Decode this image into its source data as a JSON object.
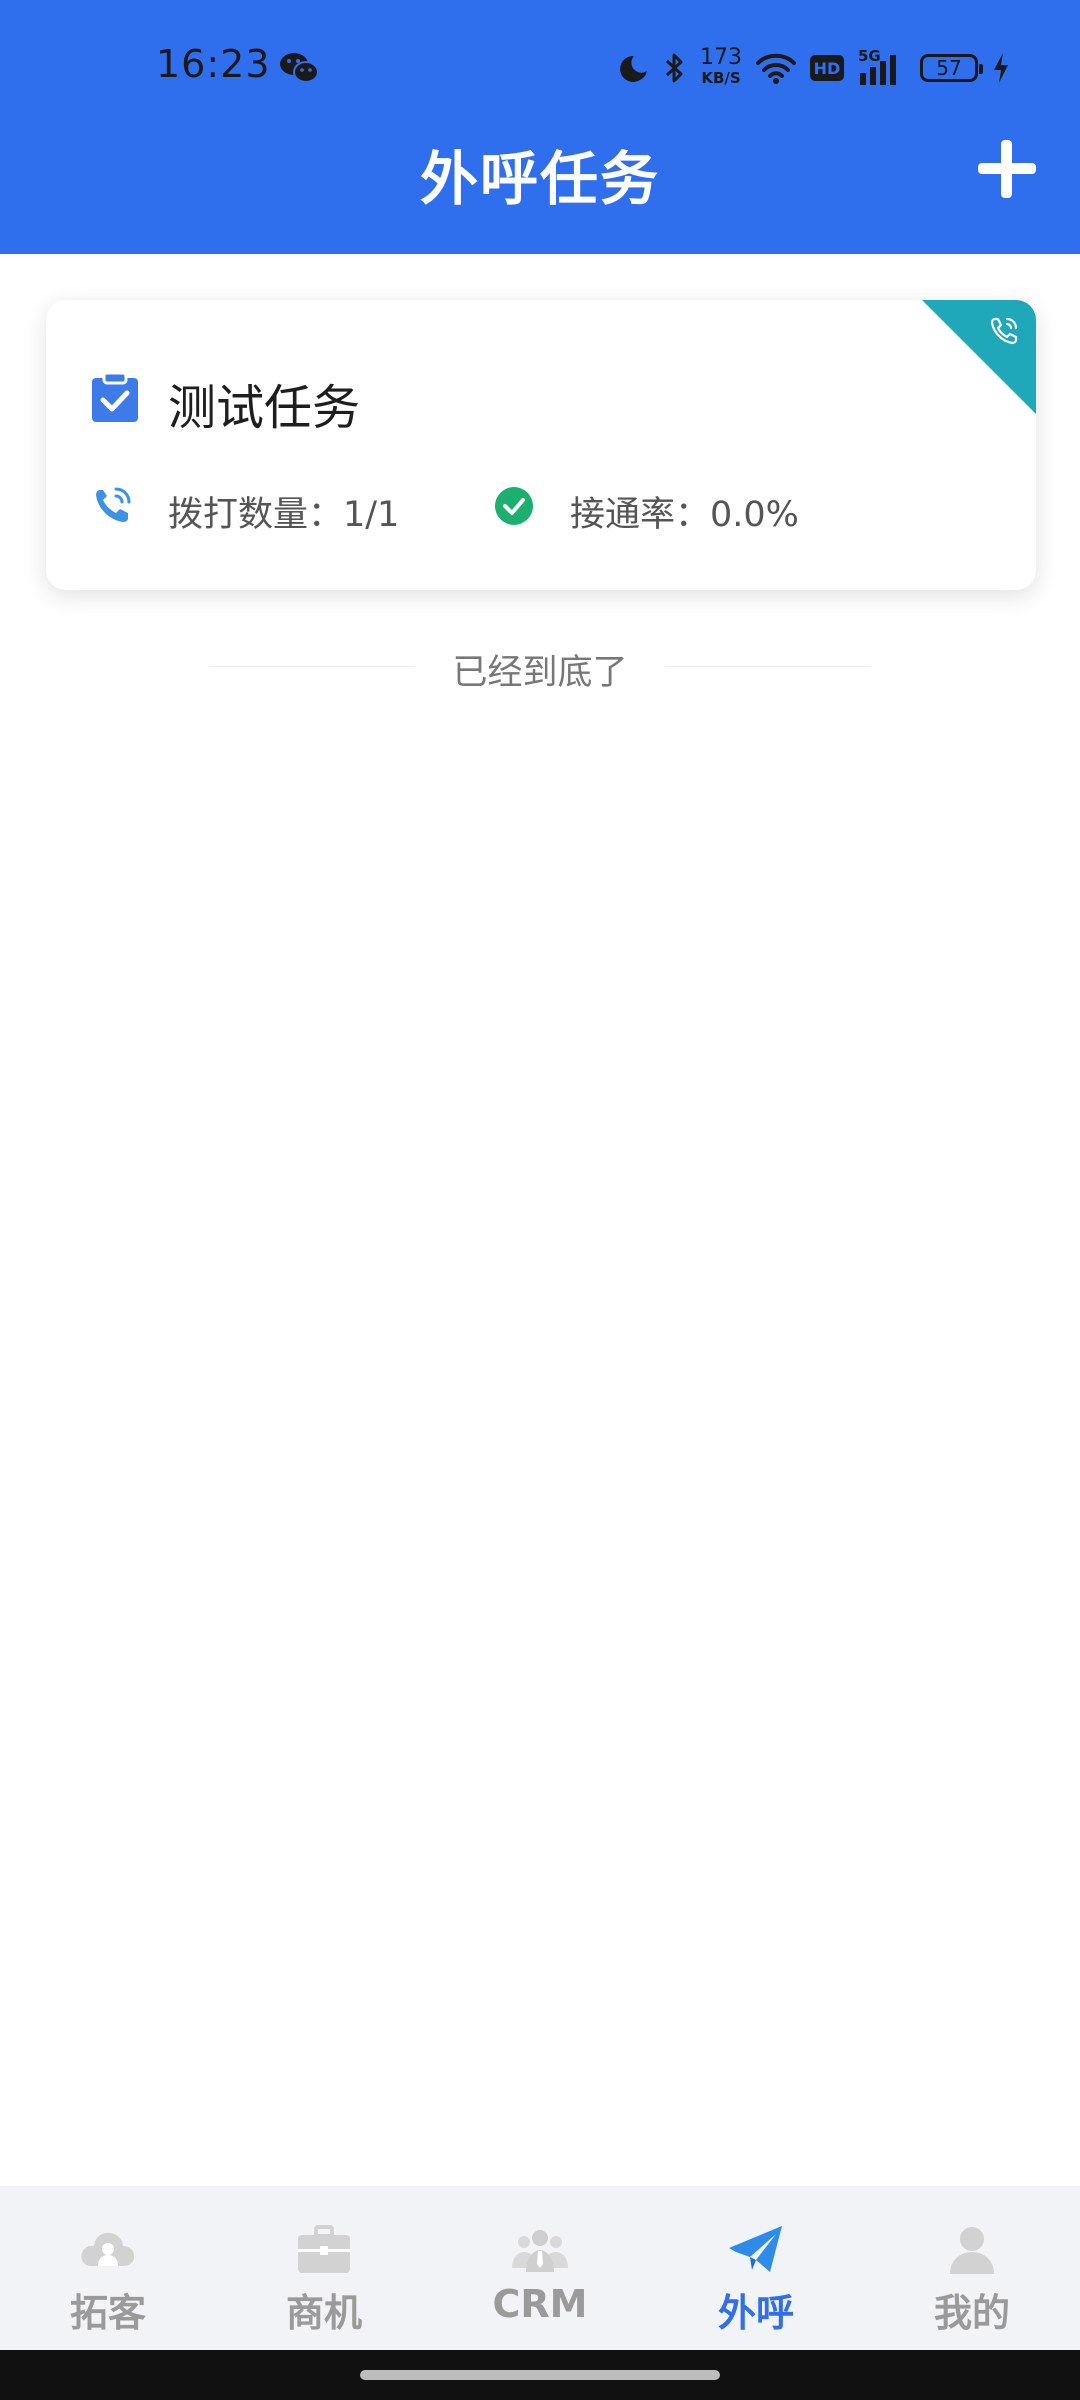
{
  "status_bar": {
    "time": "16:23",
    "net_speed_value": "173",
    "net_speed_unit": "KB/S",
    "hd_label": "HD",
    "signal_label": "5G",
    "battery_level": "57"
  },
  "header": {
    "title": "外呼任务"
  },
  "tasks": [
    {
      "title": "测试任务",
      "dial_count_text": "拨打数量：1/1",
      "connect_rate_text": "接通率：0.0%"
    }
  ],
  "list_end_text": "已经到底了",
  "tab_bar": {
    "items": [
      {
        "label": "拓客",
        "icon": "cloud-user-icon",
        "active": false
      },
      {
        "label": "商机",
        "icon": "briefcase-icon",
        "active": false
      },
      {
        "label": "CRM",
        "icon": "team-icon",
        "active": false
      },
      {
        "label": "外呼",
        "icon": "paper-plane-icon",
        "active": true
      },
      {
        "label": "我的",
        "icon": "person-icon",
        "active": false
      }
    ]
  },
  "colors": {
    "primary": "#2F6FEE",
    "ribbon": "#1FA8B8",
    "check_green": "#1DAF6E",
    "tab_inactive": "#9a9a9a",
    "tab_bar_bg": "#F2F3F7"
  }
}
